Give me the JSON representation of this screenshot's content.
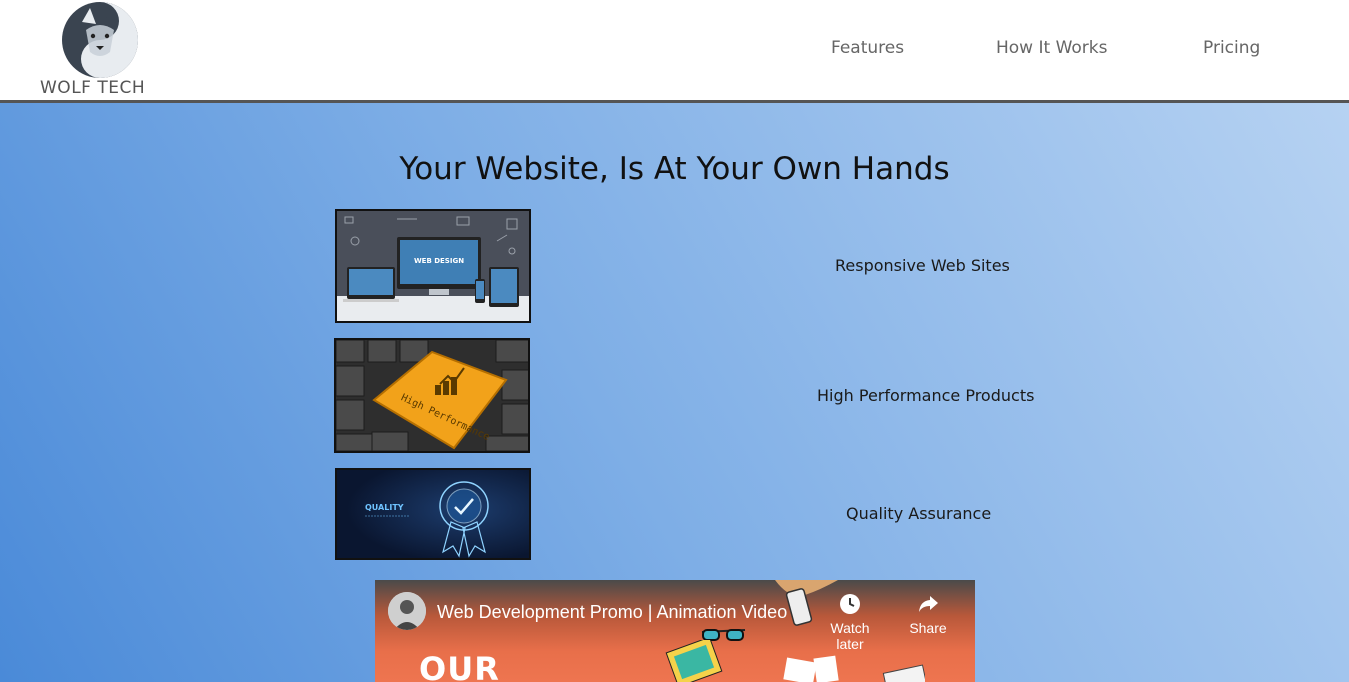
{
  "header": {
    "brand": "WOLF TECH",
    "logo_icon": "wolf-logo-icon",
    "nav": [
      {
        "label": "Features"
      },
      {
        "label": "How It Works"
      },
      {
        "label": "Pricing"
      }
    ]
  },
  "hero": {
    "title": "Your Website, Is At Your Own Hands",
    "features": [
      {
        "label": "Responsive Web Sites",
        "image_text": "WEB DESIGN"
      },
      {
        "label": "High Performance Products",
        "image_text": "High Performance"
      },
      {
        "label": "Quality Assurance",
        "image_text": "QUALITY"
      }
    ]
  },
  "video": {
    "title": "Web Development Promo | Animation Video",
    "watch_later": "Watch later",
    "share": "Share",
    "overlay_text": "OUR"
  },
  "colors": {
    "header_bg": "#ffffff",
    "header_border": "#555555",
    "hero_gradient_start": "#4a8ad8",
    "hero_gradient_end": "#b6d2f2",
    "video_bg": "#ee7550"
  }
}
